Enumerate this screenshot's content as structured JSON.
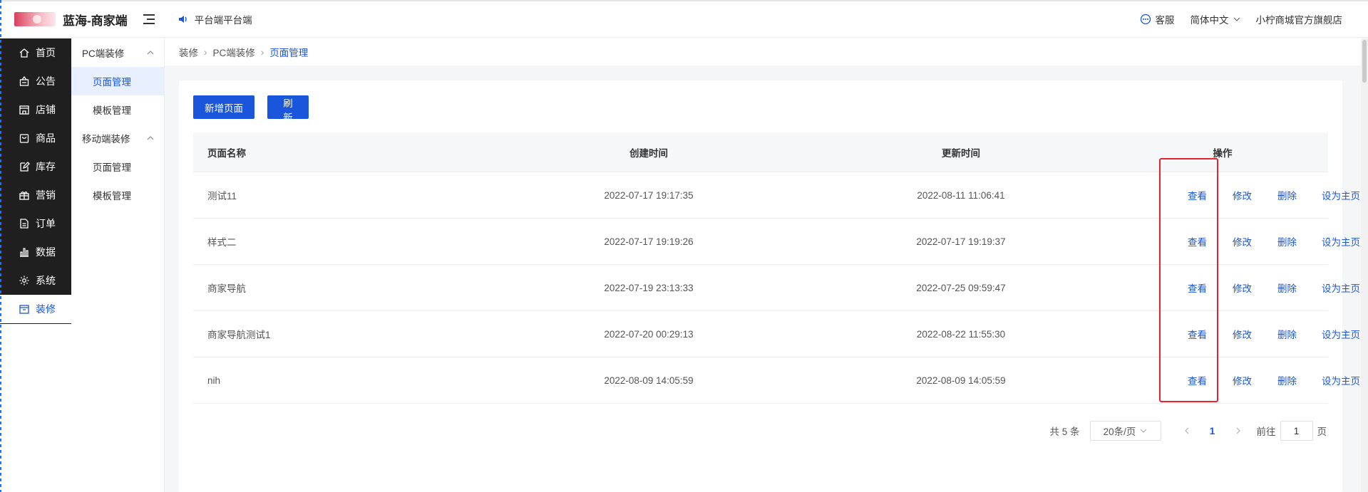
{
  "app": {
    "brand": "蓝海-商家端",
    "notice": "平台端平台端"
  },
  "header": {
    "service": "客服",
    "language": "简体中文",
    "shop": "小柠商城官方旗舰店"
  },
  "sidebar": {
    "items": [
      {
        "label": "首页",
        "icon": "home-icon"
      },
      {
        "label": "公告",
        "icon": "notice-icon"
      },
      {
        "label": "店铺",
        "icon": "shop-icon"
      },
      {
        "label": "商品",
        "icon": "goods-icon"
      },
      {
        "label": "库存",
        "icon": "edit-icon"
      },
      {
        "label": "营销",
        "icon": "gift-icon"
      },
      {
        "label": "订单",
        "icon": "order-icon"
      },
      {
        "label": "数据",
        "icon": "chart-icon"
      },
      {
        "label": "系统",
        "icon": "gear-icon"
      },
      {
        "label": "装修",
        "icon": "decorate-icon"
      }
    ],
    "active": "装修"
  },
  "submenu": {
    "groups": [
      {
        "label": "PC端装修",
        "items": [
          "页面管理",
          "模板管理"
        ]
      },
      {
        "label": "移动端装修",
        "items": [
          "页面管理",
          "模板管理"
        ]
      }
    ]
  },
  "breadcrumb": [
    "装修",
    "PC端装修",
    "页面管理"
  ],
  "toolbar": {
    "add": "新增页面",
    "refresh": "刷新"
  },
  "table": {
    "columns": [
      "页面名称",
      "创建时间",
      "更新时间",
      "操作"
    ],
    "actions": [
      "查看",
      "修改",
      "删除",
      "设为主页"
    ],
    "rows": [
      {
        "name": "测试11",
        "created": "2022-07-17 19:17:35",
        "updated": "2022-08-11 11:06:41"
      },
      {
        "name": "样式二",
        "created": "2022-07-17 19:19:26",
        "updated": "2022-07-17 19:19:37"
      },
      {
        "name": "商家导航",
        "created": "2022-07-19 23:13:33",
        "updated": "2022-07-25 09:59:47"
      },
      {
        "name": "商家导航测试1",
        "created": "2022-07-20 00:29:13",
        "updated": "2022-08-22 11:55:30"
      },
      {
        "name": "nih",
        "created": "2022-08-09 14:05:59",
        "updated": "2022-08-09 14:05:59"
      }
    ]
  },
  "pagination": {
    "total": "共 5 条",
    "size": "20条/页",
    "current": "1",
    "goto": "前往",
    "page_value": "1",
    "page_unit": "页"
  },
  "colors": {
    "primary": "#1a56db",
    "highlight": "#e8232a",
    "sidebar_bg": "#1f1f1f"
  }
}
